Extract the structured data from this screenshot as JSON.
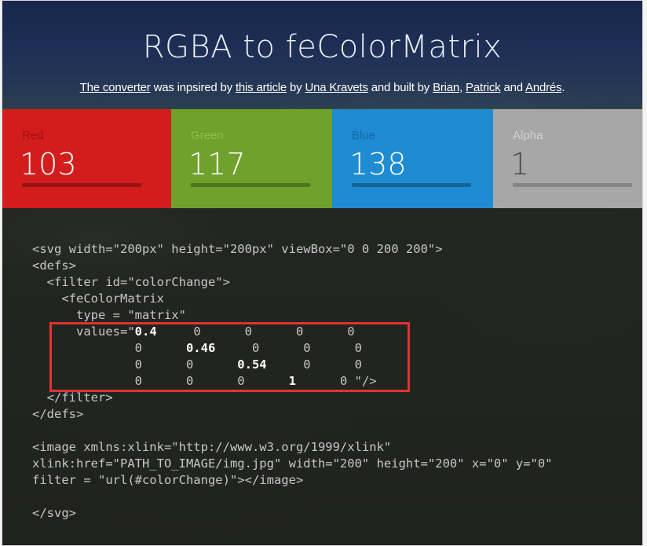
{
  "header": {
    "title": "RGBA to feColorMatrix",
    "credit": {
      "link_converter": "The converter",
      "text_1": " was inpsired by ",
      "link_article": "this article",
      "text_2": " by ",
      "link_author": "Una Kravets",
      "text_3": " and built by ",
      "link_brian": "Brian",
      "text_4": ", ",
      "link_patrick": "Patrick",
      "text_5": " and ",
      "link_andres": "Andrés",
      "text_6": "."
    }
  },
  "channels": {
    "red": {
      "label": "Red",
      "value": "103",
      "color": "#d31d1d"
    },
    "green": {
      "label": "Green",
      "value": "117",
      "color": "#6fa12c"
    },
    "blue": {
      "label": "Blue",
      "value": "138",
      "color": "#1e8bd3"
    },
    "alpha": {
      "label": "Alpha",
      "value": "1",
      "color": "#a7a7a7"
    }
  },
  "code": {
    "l1": "<svg width=\"200px\" height=\"200px\" viewBox=\"0 0 200 200\">",
    "l2": "<defs>",
    "l3": "  <filter id=\"colorChange\">",
    "l4": "    <feColorMatrix",
    "l5": "      type = \"matrix\"",
    "l6_pre": "      values=\"",
    "m_r": "0.4",
    "l6_post": "     0      0      0      0",
    "l7_pre": "              0      ",
    "m_g": "0.46",
    "l7_post": "     0      0      0",
    "l8_pre": "              0      0      ",
    "m_b": "0.54",
    "l8_post": "     0      0",
    "l9_pre": "              0      0      0      ",
    "m_a": "1",
    "l9_post": "      0 \"/>",
    "l10": "  </filter>",
    "l11": "</defs>",
    "l12": "",
    "l13": "<image xmlns:xlink=\"http://www.w3.org/1999/xlink\"",
    "l14": "xlink:href=\"PATH_TO_IMAGE/img.jpg\" width=\"200\" height=\"200\" x=\"0\" y=\"0\"",
    "l15": "filter = \"url(#colorChange)\"></image>",
    "l16": "",
    "l17": "</svg>"
  }
}
